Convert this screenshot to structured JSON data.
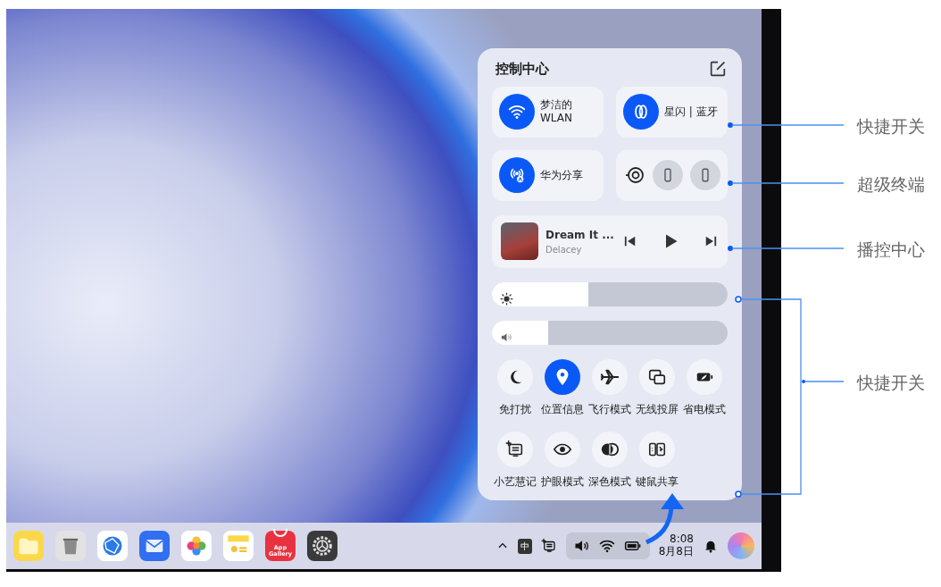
{
  "control_center": {
    "title": "控制中心",
    "tiles": [
      {
        "kind": "wlan",
        "lines": [
          "梦洁的",
          "WLAN"
        ],
        "on": true
      },
      {
        "kind": "starflash",
        "lines": [
          "星闪 | 蓝牙"
        ],
        "on": true
      },
      {
        "kind": "share",
        "lines": [
          "华为分享"
        ],
        "on": true
      },
      {
        "kind": "devices"
      }
    ],
    "media": {
      "title": "Dream It ...",
      "artist": "Delacey",
      "playing": false
    },
    "sliders": [
      {
        "kind": "brightness",
        "level": 0.41
      },
      {
        "kind": "volume",
        "level": 0.24
      }
    ],
    "toggles": [
      {
        "kind": "moon",
        "label": "免打扰",
        "on": false
      },
      {
        "kind": "pin",
        "label": "位置信息",
        "on": true
      },
      {
        "kind": "plane",
        "label": "飞行模式",
        "on": false
      },
      {
        "kind": "cast",
        "label": "无线投屏",
        "on": false
      },
      {
        "kind": "battery",
        "label": "省电模式",
        "on": false
      },
      {
        "kind": "note",
        "label": "小艺慧记",
        "on": false
      },
      {
        "kind": "eye",
        "label": "护眼模式",
        "on": false
      },
      {
        "kind": "contrast",
        "label": "深色模式",
        "on": false
      },
      {
        "kind": "kbd",
        "label": "键鼠共享",
        "on": false
      }
    ]
  },
  "taskbar": {
    "apps": [
      {
        "kind": "folder"
      },
      {
        "kind": "trash"
      },
      {
        "kind": "browser"
      },
      {
        "kind": "mail"
      },
      {
        "kind": "photos"
      },
      {
        "kind": "notes"
      },
      {
        "kind": "store",
        "text": "App Gallery"
      },
      {
        "kind": "settings"
      }
    ],
    "ime": "中",
    "time": "8:08",
    "date": "8月8日"
  },
  "annotations": [
    "快捷开关",
    "超级终端",
    "播控中心",
    "快捷开关"
  ]
}
